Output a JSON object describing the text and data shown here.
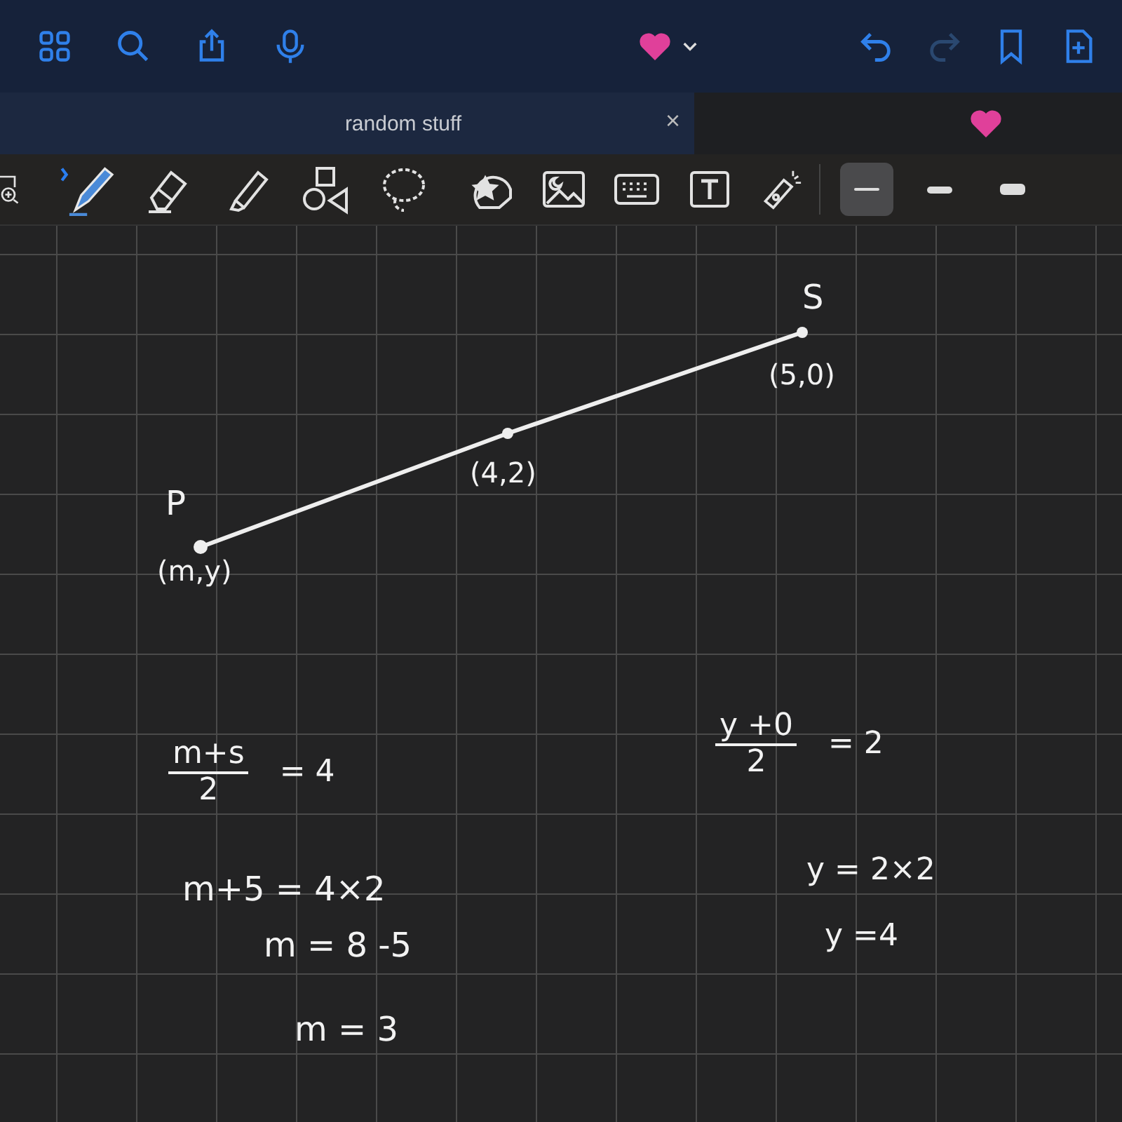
{
  "top_bar": {
    "left_icons": [
      {
        "kind": "grid"
      },
      {
        "kind": "search"
      },
      {
        "kind": "share"
      },
      {
        "kind": "mic"
      }
    ],
    "right_icons": [
      {
        "kind": "undo",
        "disabled": false
      },
      {
        "kind": "redo",
        "disabled": true
      },
      {
        "kind": "bookmark",
        "disabled": false
      },
      {
        "kind": "add-page",
        "disabled": false
      }
    ]
  },
  "tabs": [
    {
      "label": "random stuff",
      "selected": true,
      "close": "×"
    },
    {
      "kind": "heart",
      "selected": false
    }
  ],
  "tools": [
    {
      "kind": "zoom"
    },
    {
      "kind": "pen"
    },
    {
      "kind": "eraser"
    },
    {
      "kind": "highlighter"
    },
    {
      "kind": "shapes"
    },
    {
      "kind": "lasso"
    },
    {
      "kind": "sticker"
    },
    {
      "kind": "image"
    },
    {
      "kind": "keyboard"
    },
    {
      "kind": "text"
    },
    {
      "kind": "laser"
    }
  ],
  "stroke_widths": [
    {
      "selected": true
    },
    {
      "selected": false
    },
    {
      "selected": false
    }
  ],
  "notes": [
    {
      "kind": "label",
      "text": "P"
    },
    {
      "kind": "label",
      "text": "(m,y)"
    },
    {
      "kind": "label",
      "text": "(4,2)"
    },
    {
      "kind": "label",
      "text": "S"
    },
    {
      "kind": "label",
      "text": "(5,0)"
    },
    {
      "kind": "fraction",
      "numerator": "m+s",
      "denominator": "2",
      "rhs": "= 4"
    },
    {
      "kind": "label",
      "text": "m+5  = 4×2"
    },
    {
      "kind": "label",
      "text": "m  =  8  -5"
    },
    {
      "kind": "label",
      "text": "m = 3"
    },
    {
      "kind": "fraction",
      "numerator": "y +0",
      "denominator": "2",
      "rhs": "= 2"
    },
    {
      "kind": "label",
      "text": "y = 2×2"
    },
    {
      "kind": "label",
      "text": "y =4"
    }
  ]
}
